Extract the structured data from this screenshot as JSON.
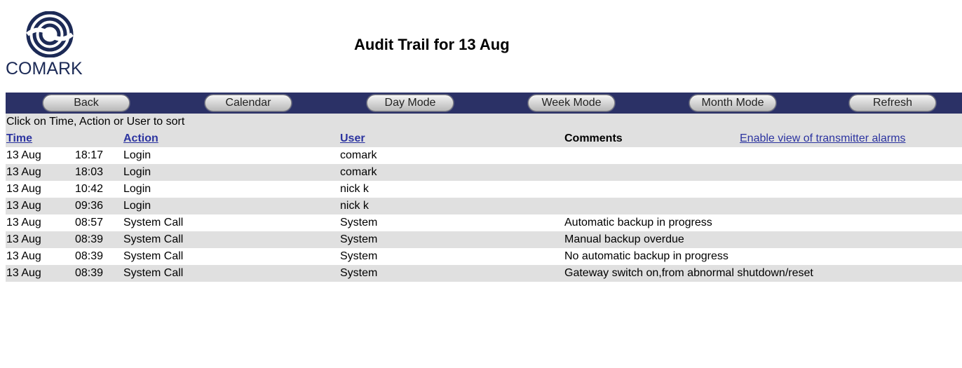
{
  "logo": {
    "text": "COMARK"
  },
  "page_title": "Audit Trail for 13 Aug",
  "toolbar": {
    "buttons": [
      {
        "label": "Back"
      },
      {
        "label": "Calendar"
      },
      {
        "label": "Day Mode"
      },
      {
        "label": "Week Mode"
      },
      {
        "label": "Month Mode"
      },
      {
        "label": "Refresh"
      }
    ]
  },
  "hint": "Click on Time, Action or User to sort",
  "table": {
    "headers": {
      "time": "Time",
      "action": "Action",
      "user": "User",
      "comments": "Comments",
      "alarm_link": "Enable view of transmitter alarms"
    },
    "rows": [
      {
        "date": "13 Aug",
        "time": "18:17",
        "action": "Login",
        "user": "comark",
        "comment": ""
      },
      {
        "date": "13 Aug",
        "time": "18:03",
        "action": "Login",
        "user": "comark",
        "comment": ""
      },
      {
        "date": "13 Aug",
        "time": "10:42",
        "action": "Login",
        "user": "nick k",
        "comment": ""
      },
      {
        "date": "13 Aug",
        "time": "09:36",
        "action": "Login",
        "user": "nick k",
        "comment": ""
      },
      {
        "date": "13 Aug",
        "time": "08:57",
        "action": "System Call",
        "user": "System",
        "comment": "Automatic backup in progress"
      },
      {
        "date": "13 Aug",
        "time": "08:39",
        "action": "System Call",
        "user": "System",
        "comment": "Manual backup overdue"
      },
      {
        "date": "13 Aug",
        "time": "08:39",
        "action": "System Call",
        "user": "System",
        "comment": "No automatic backup in progress"
      },
      {
        "date": "13 Aug",
        "time": "08:39",
        "action": "System Call",
        "user": "System",
        "comment": "Gateway switch on,from abnormal shutdown/reset"
      }
    ]
  },
  "colors": {
    "toolbar_bg": "#2b3166",
    "row_alt_bg": "#e0e0e0",
    "link": "#2c34a0",
    "logo": "#1c2a56"
  }
}
